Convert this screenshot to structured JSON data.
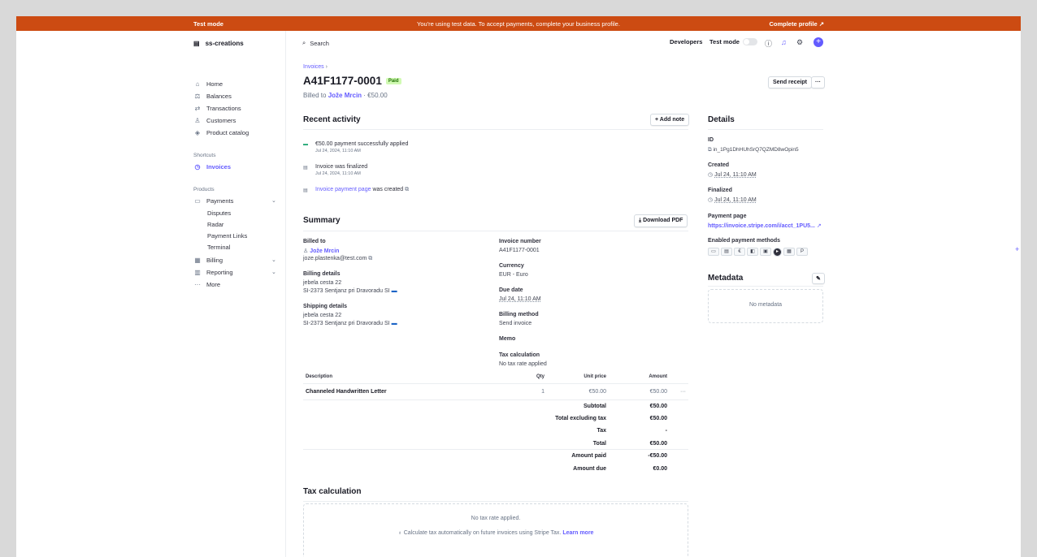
{
  "banner": {
    "left": "Test mode",
    "message": "You're using test data. To accept payments, complete your business profile.",
    "cta": "Complete profile ↗"
  },
  "sidebar": {
    "account": "ss-creations",
    "items": [
      {
        "label": "Home",
        "icon": "home-icon"
      },
      {
        "label": "Balances",
        "icon": "balances-icon"
      },
      {
        "label": "Transactions",
        "icon": "transactions-icon"
      },
      {
        "label": "Customers",
        "icon": "customers-icon"
      },
      {
        "label": "Product catalog",
        "icon": "product-catalog-icon"
      }
    ],
    "shortcuts_heading": "Shortcuts",
    "shortcut": "Invoices",
    "products_heading": "Products",
    "payments": "Payments",
    "payments_sub": [
      "Disputes",
      "Radar",
      "Payment Links",
      "Terminal"
    ],
    "billing": "Billing",
    "reporting": "Reporting",
    "more": "More"
  },
  "topbar": {
    "search": "Search",
    "developers": "Developers",
    "test_mode": "Test mode"
  },
  "invoice": {
    "breadcrumb": "Invoices",
    "number": "A41F1177-0001",
    "status": "Paid",
    "billed_prefix": "Billed to",
    "customer": "Jože Mrcin",
    "amount_suffix": "· €50.00",
    "send_receipt": "Send receipt",
    "more_button": "···"
  },
  "activity": {
    "title": "Recent activity",
    "add_note": "+ Add note",
    "events": [
      {
        "text": "€50.00 payment successfully applied",
        "date": "Jul 24, 2024, 11:10 AM"
      },
      {
        "text": "Invoice was finalized",
        "date": "Jul 24, 2024, 11:10 AM"
      },
      {
        "link": "Invoice payment page",
        "text": "was created",
        "date": ""
      }
    ]
  },
  "summary": {
    "title": "Summary",
    "download": "Download PDF",
    "billed_to_label": "Billed to",
    "billed_to_name": "Jože Mrcin",
    "billed_to_email": "joze.plastenka@test.com",
    "billing_details_label": "Billing details",
    "billing_line1": "jebela cesta 22",
    "billing_line2": "SI-2373 Sentjanz pri Dravoradu SI",
    "shipping_details_label": "Shipping details",
    "shipping_line1": "jebela cesta 22",
    "shipping_line2": "SI-2373 Sentjanz pri Dravoradu SI",
    "invoice_number_label": "Invoice number",
    "invoice_number": "A41F1177-0001",
    "currency_label": "Currency",
    "currency": "EUR - Euro",
    "due_label": "Due date",
    "due": "Jul 24, 11:10 AM",
    "billing_method_label": "Billing method",
    "billing_method": "Send invoice",
    "memo_label": "Memo",
    "tax_calc_label": "Tax calculation",
    "tax_calc": "No tax rate applied"
  },
  "line_items": {
    "headers": {
      "description": "Description",
      "qty": "Qty",
      "unit_price": "Unit price",
      "amount": "Amount"
    },
    "rows": [
      {
        "description": "Channeled Handwritten Letter",
        "qty": "1",
        "unit_price": "€50.00",
        "amount": "€50.00"
      }
    ],
    "totals": [
      {
        "label": "Subtotal",
        "value": "€50.00"
      },
      {
        "label": "Total excluding tax",
        "value": "€50.00"
      },
      {
        "label": "Tax",
        "value": "-"
      },
      {
        "label": "Total",
        "value": "€50.00"
      },
      {
        "label": "Amount paid",
        "value": "-€50.00"
      },
      {
        "label": "Amount due",
        "value": "€0.00"
      }
    ]
  },
  "tax_section": {
    "title": "Tax calculation",
    "empty": "No tax rate applied.",
    "cta_text": "Calculate tax automatically on future invoices using Stripe Tax.",
    "cta_link": "Learn more"
  },
  "details": {
    "title": "Details",
    "id_label": "ID",
    "id": "in_1Pg1DhHUhSrQ7QZMD8wOpin5",
    "created_label": "Created",
    "created": "Jul 24, 11:10 AM",
    "finalized_label": "Finalized",
    "finalized": "Jul 24, 11:10 AM",
    "payment_page_label": "Payment page",
    "payment_page": "https://invoice.stripe.com/i/acct_1PU5...",
    "methods_label": "Enabled payment methods"
  },
  "metadata": {
    "title": "Metadata",
    "empty": "No metadata"
  },
  "colors": {
    "banner": "#cc4b12",
    "accent": "#635bff",
    "paid_bg": "#d1fab3"
  }
}
